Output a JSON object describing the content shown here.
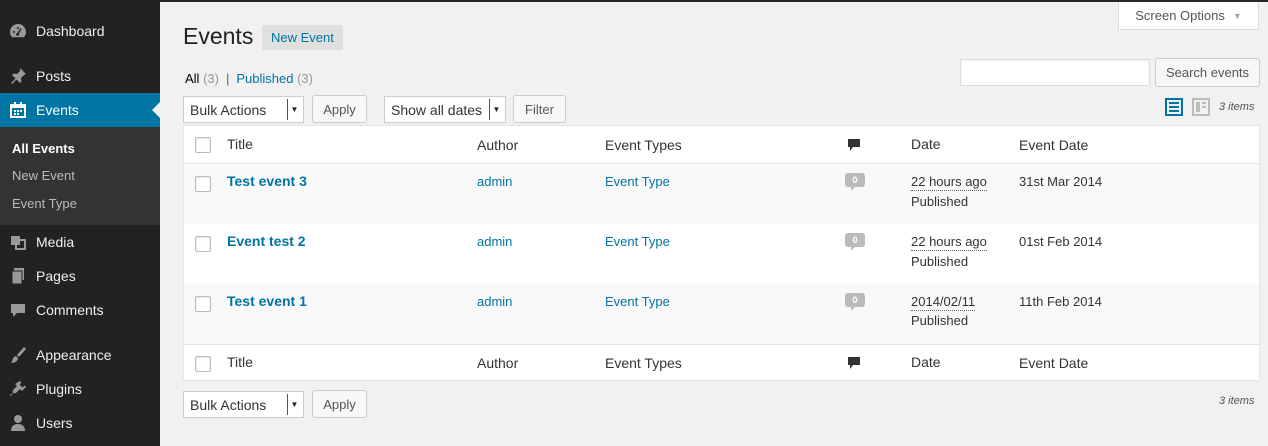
{
  "sidebar": {
    "items": [
      {
        "label": "Dashboard",
        "icon": "dashboard-icon"
      },
      {
        "label": "Posts",
        "icon": "pin-icon"
      },
      {
        "label": "Events",
        "icon": "calendar-icon"
      },
      {
        "label": "Media",
        "icon": "media-icon"
      },
      {
        "label": "Pages",
        "icon": "pages-icon"
      },
      {
        "label": "Comments",
        "icon": "comment-icon"
      },
      {
        "label": "Appearance",
        "icon": "brush-icon"
      },
      {
        "label": "Plugins",
        "icon": "plug-icon"
      },
      {
        "label": "Users",
        "icon": "user-icon"
      }
    ],
    "submenu": [
      "All Events",
      "New Event",
      "Event Type"
    ]
  },
  "screen_options": "Screen Options",
  "page": {
    "title": "Events",
    "add_new": "New Event"
  },
  "views": {
    "all_label": "All",
    "all_count": "(3)",
    "separator": "|",
    "published_label": "Published",
    "published_count": "(3)"
  },
  "search": {
    "value": "",
    "button": "Search events"
  },
  "tablenav": {
    "bulk_actions": "Bulk Actions",
    "apply": "Apply",
    "dates": "Show all dates",
    "filter": "Filter",
    "items_count": "3 items"
  },
  "table": {
    "columns": [
      "Title",
      "Author",
      "Event Types",
      "comments-icon",
      "Date",
      "Event Date"
    ],
    "rows": [
      {
        "title": "Test event 3",
        "author": "admin",
        "type": "Event Type",
        "comments": "0",
        "date": "22 hours ago",
        "status": "Published",
        "event_date": "31st Mar 2014"
      },
      {
        "title": "Event test 2",
        "author": "admin",
        "type": "Event Type",
        "comments": "0",
        "date": "22 hours ago",
        "status": "Published",
        "event_date": "01st Feb 2014"
      },
      {
        "title": "Test event 1",
        "author": "admin",
        "type": "Event Type",
        "comments": "0",
        "date": "2014/02/11",
        "status": "Published",
        "event_date": "11th Feb 2014"
      }
    ]
  },
  "colors": {
    "accent": "#0074a2",
    "sidebar": "#222222",
    "background": "#f1f1f1"
  }
}
